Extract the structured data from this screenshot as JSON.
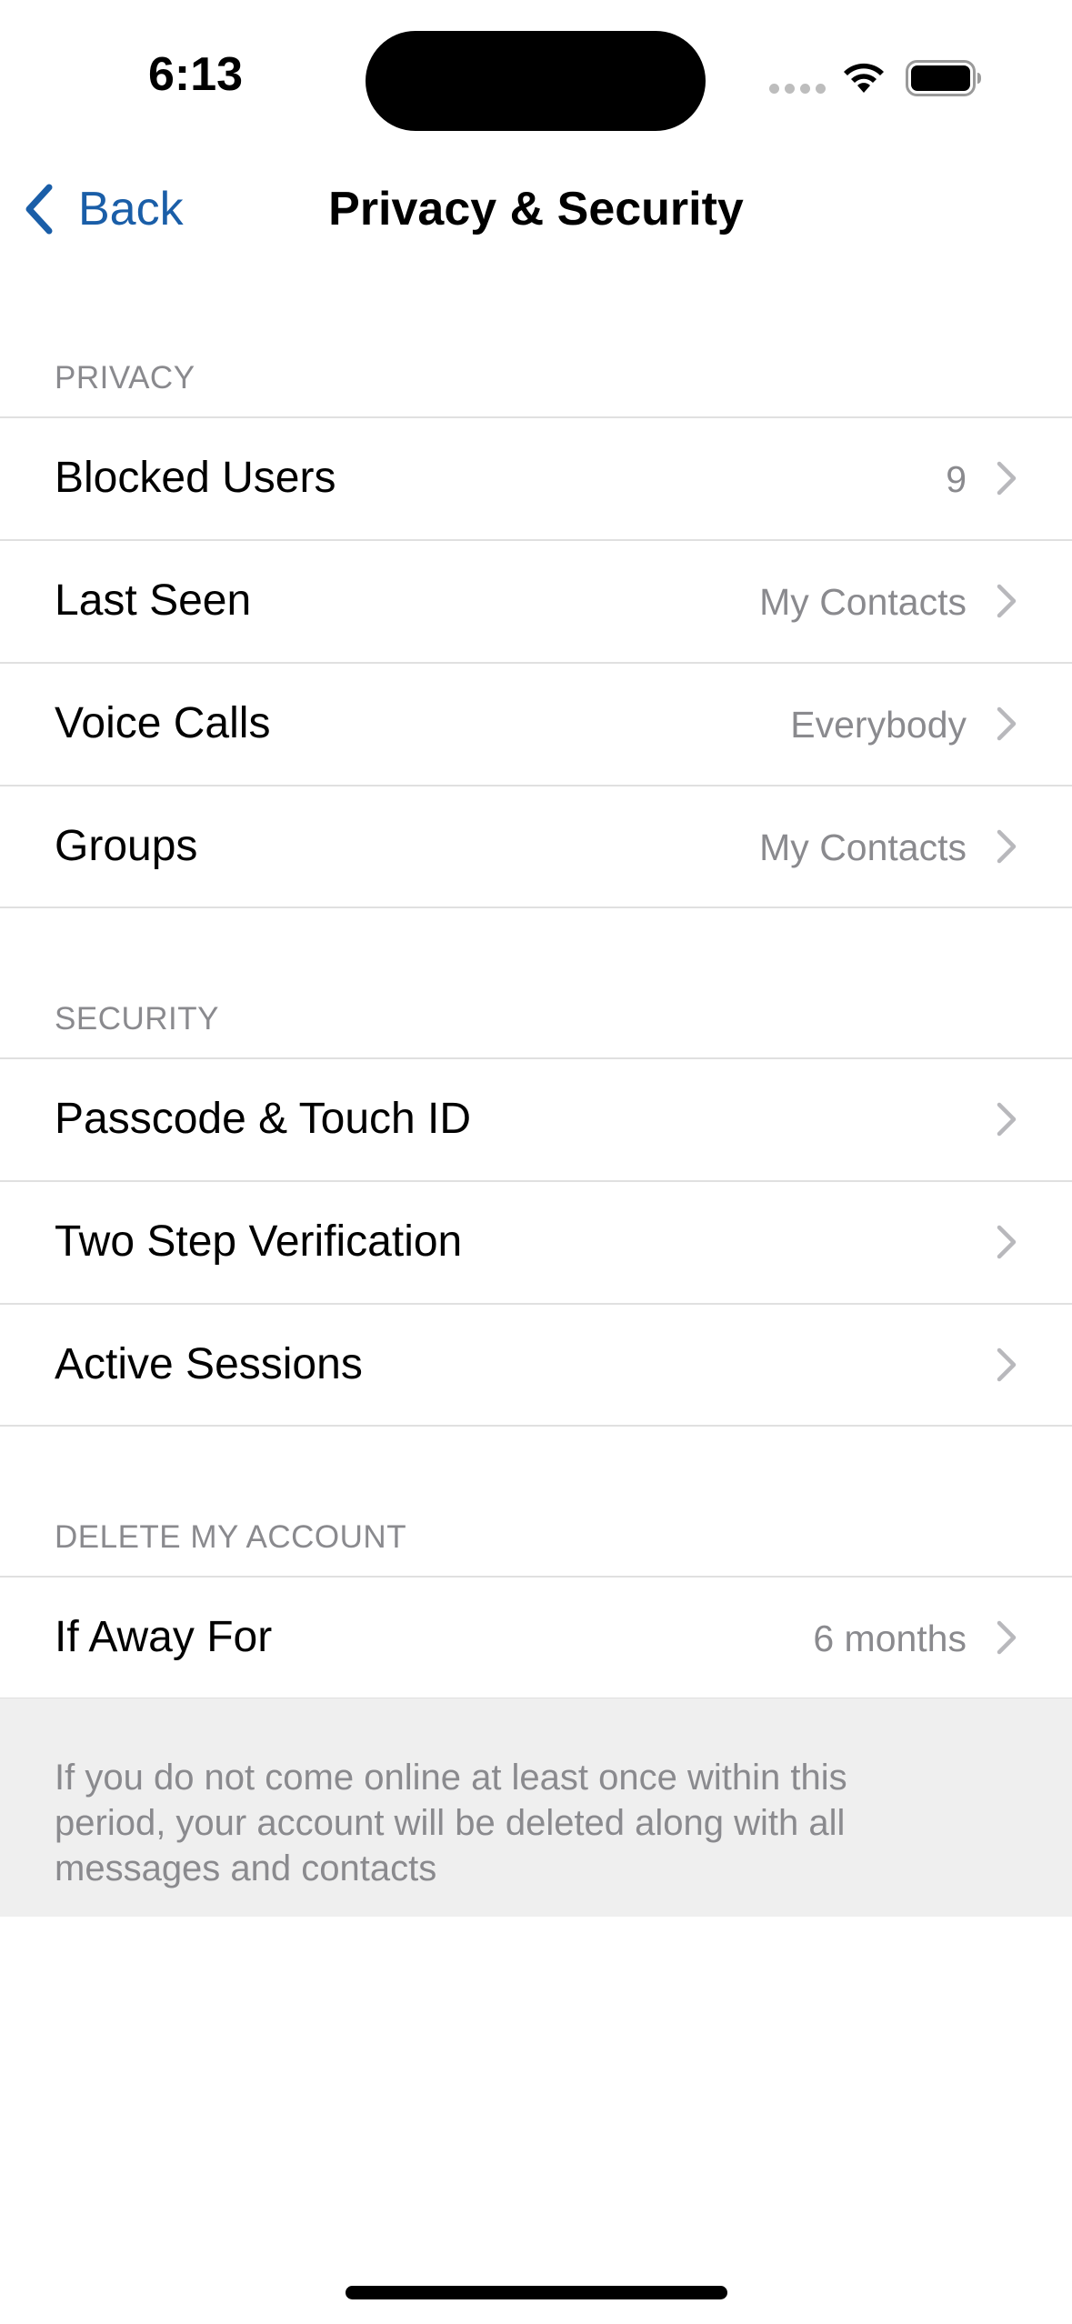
{
  "status_bar": {
    "time": "6:13",
    "icons": [
      "signal-icon",
      "wifi-icon",
      "battery-icon"
    ]
  },
  "nav": {
    "back_label": "Back",
    "title": "Privacy & Security",
    "accent_color": "#1a5ea8"
  },
  "sections": {
    "privacy": {
      "header": "PRIVACY",
      "rows": [
        {
          "label": "Blocked Users",
          "value": "9"
        },
        {
          "label": "Last Seen",
          "value": "My Contacts"
        },
        {
          "label": "Voice Calls",
          "value": "Everybody"
        },
        {
          "label": "Groups",
          "value": "My Contacts"
        }
      ]
    },
    "security": {
      "header": "SECURITY",
      "rows": [
        {
          "label": "Passcode & Touch ID"
        },
        {
          "label": "Two Step Verification"
        },
        {
          "label": "Active Sessions"
        }
      ]
    },
    "delete_account": {
      "header": "DELETE MY ACCOUNT",
      "rows": [
        {
          "label": "If Away For",
          "value": "6 months"
        }
      ],
      "footer": "If you do not come online at least once within this period, your account will be deleted along with all messages and contacts"
    }
  }
}
